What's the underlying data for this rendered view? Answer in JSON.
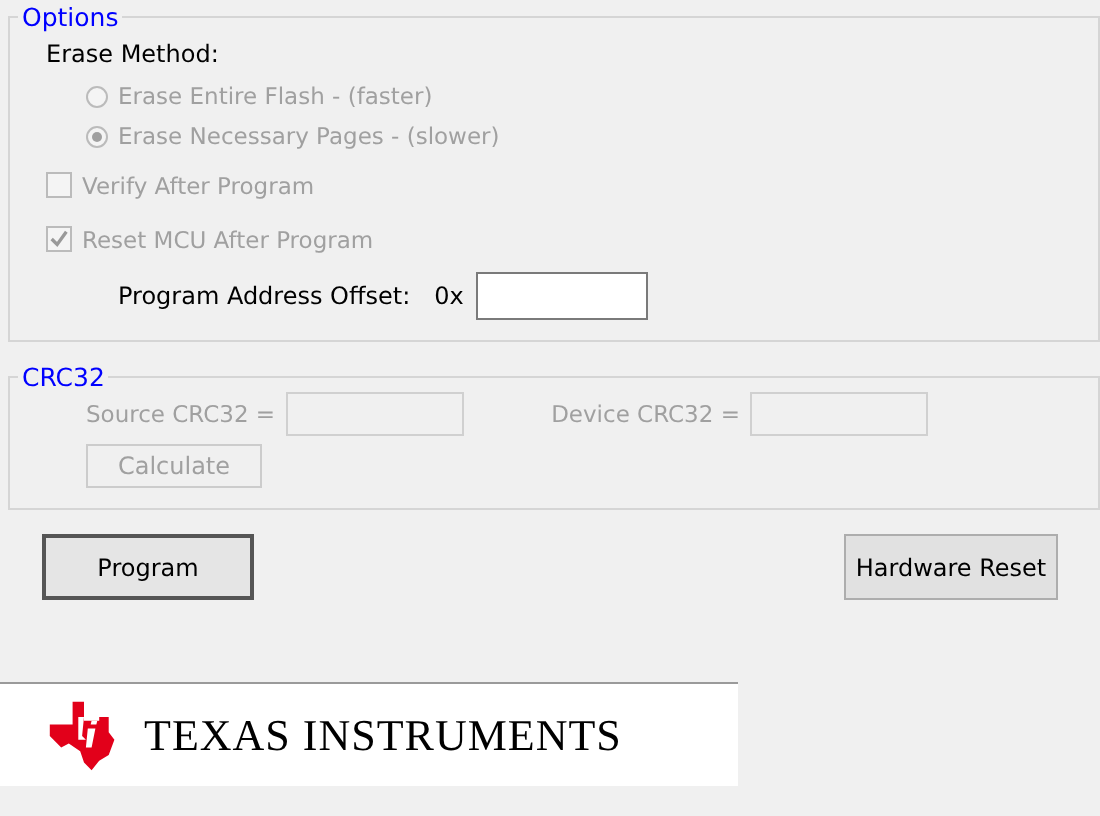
{
  "options": {
    "title": "Options",
    "erase_method_label": "Erase Method:",
    "erase_methods": [
      {
        "label": "Erase Entire Flash - (faster)",
        "selected": false,
        "disabled": true
      },
      {
        "label": "Erase Necessary Pages - (slower)",
        "selected": true,
        "disabled": true
      }
    ],
    "checkboxes": [
      {
        "label": "Verify After Program",
        "checked": false,
        "disabled": true
      },
      {
        "label": "Reset MCU After Program",
        "checked": true,
        "disabled": true
      }
    ],
    "address_offset": {
      "label": "Program Address Offset:",
      "prefix": "0x",
      "disabled": false
    }
  },
  "crc32": {
    "title": "CRC32",
    "source_label": "Source CRC32 =",
    "device_label": "Device CRC32 =",
    "disabled": true,
    "calculate_button": "Calculate"
  },
  "buttons": [
    {
      "label": "Program",
      "default": true
    },
    {
      "label": "Hardware Reset",
      "default": false
    }
  ],
  "logo": {
    "text": "TEXAS INSTRUMENTS"
  }
}
